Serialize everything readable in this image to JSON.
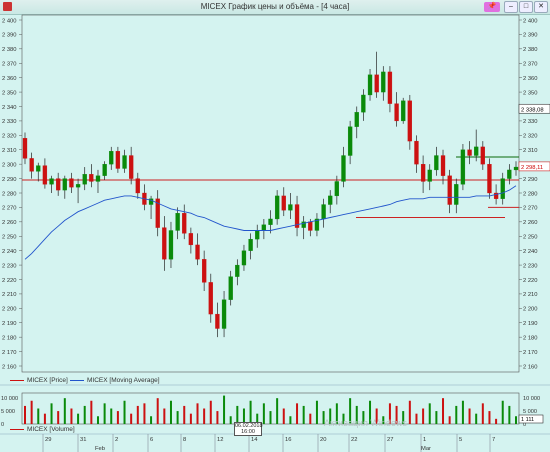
{
  "window": {
    "title": "MICEX График цены и объёма - [4 часа]",
    "minimize": "–",
    "maximize": "□",
    "close": "✕",
    "pin": "📌"
  },
  "price_axis": {
    "ticks": [
      "2 400",
      "2 390",
      "2 380",
      "2 370",
      "2 360",
      "2 350",
      "2 340",
      "2 330",
      "2 320",
      "2 310",
      "2 300",
      "2 290",
      "2 280",
      "2 270",
      "2 260",
      "2 250",
      "2 240",
      "2 230",
      "2 220",
      "2 210",
      "2 200",
      "2 190",
      "2 180",
      "2 170",
      "2 160"
    ],
    "badge_upper": "2 338,08",
    "badge_current": "2 298,11"
  },
  "volume_axis": {
    "ticks": [
      "10 000",
      "5 000",
      "0"
    ],
    "badge": "1 111"
  },
  "legend": {
    "price": "MICEX [Price]",
    "ma": "MICEX [Moving Average]",
    "volume": "MICEX [Volume]"
  },
  "date_axis": {
    "days": [
      "29",
      "31",
      "2",
      "6",
      "8",
      "12",
      "14",
      "16",
      "20",
      "22",
      "27",
      "1",
      "5",
      "7"
    ],
    "months": [
      "Feb",
      "Mar"
    ],
    "crosshair_date": "06.02.2018",
    "crosshair_time": "16:00"
  },
  "watermark": "Активация Windows",
  "colors": {
    "up": "#0a8a0a",
    "down": "#cc1111",
    "ma": "#2255cc",
    "hline": "#cc2222",
    "hline_green": "#0a6a0a",
    "background": "#d4f3f0"
  },
  "chart_data": [
    {
      "type": "candlestick",
      "title": "MICEX График цены и объёма - [4 часа]",
      "ylim": [
        2160,
        2400
      ],
      "y_ticks": [
        2400,
        2390,
        2380,
        2370,
        2360,
        2350,
        2340,
        2330,
        2320,
        2310,
        2300,
        2290,
        2280,
        2270,
        2260,
        2250,
        2240,
        2230,
        2220,
        2210,
        2200,
        2190,
        2180,
        2170,
        2160
      ],
      "grid": false,
      "series": [
        {
          "name": "MICEX [Price]",
          "ohlc": [
            [
              2318,
              2322,
              2300,
              2304
            ],
            [
              2304,
              2308,
              2290,
              2295
            ],
            [
              2295,
              2301,
              2288,
              2299
            ],
            [
              2299,
              2304,
              2283,
              2286
            ],
            [
              2286,
              2292,
              2280,
              2290
            ],
            [
              2290,
              2294,
              2278,
              2282
            ],
            [
              2282,
              2292,
              2276,
              2290
            ],
            [
              2290,
              2294,
              2280,
              2284
            ],
            [
              2284,
              2290,
              2273,
              2286
            ],
            [
              2286,
              2298,
              2282,
              2293
            ],
            [
              2293,
              2300,
              2284,
              2288
            ],
            [
              2288,
              2296,
              2280,
              2292
            ],
            [
              2292,
              2302,
              2289,
              2300
            ],
            [
              2300,
              2312,
              2296,
              2309
            ],
            [
              2309,
              2312,
              2294,
              2297
            ],
            [
              2297,
              2310,
              2294,
              2306
            ],
            [
              2306,
              2312,
              2286,
              2290
            ],
            [
              2290,
              2294,
              2276,
              2280
            ],
            [
              2280,
              2286,
              2268,
              2272
            ],
            [
              2272,
              2278,
              2262,
              2276
            ],
            [
              2276,
              2282,
              2250,
              2256
            ],
            [
              2256,
              2264,
              2226,
              2234
            ],
            [
              2234,
              2260,
              2228,
              2254
            ],
            [
              2254,
              2270,
              2248,
              2266
            ],
            [
              2266,
              2272,
              2248,
              2252
            ],
            [
              2252,
              2256,
              2238,
              2244
            ],
            [
              2244,
              2252,
              2230,
              2234
            ],
            [
              2234,
              2240,
              2212,
              2218
            ],
            [
              2218,
              2224,
              2190,
              2196
            ],
            [
              2196,
              2204,
              2180,
              2186
            ],
            [
              2186,
              2212,
              2180,
              2206
            ],
            [
              2206,
              2226,
              2202,
              2222
            ],
            [
              2222,
              2234,
              2216,
              2230
            ],
            [
              2230,
              2244,
              2226,
              2240
            ],
            [
              2240,
              2252,
              2234,
              2248
            ],
            [
              2248,
              2258,
              2242,
              2254
            ],
            [
              2254,
              2262,
              2248,
              2258
            ],
            [
              2258,
              2268,
              2252,
              2262
            ],
            [
              2262,
              2282,
              2258,
              2278
            ],
            [
              2278,
              2284,
              2264,
              2268
            ],
            [
              2268,
              2280,
              2262,
              2272
            ],
            [
              2272,
              2278,
              2250,
              2256
            ],
            [
              2256,
              2264,
              2248,
              2260
            ],
            [
              2260,
              2262,
              2250,
              2254
            ],
            [
              2254,
              2266,
              2250,
              2262
            ],
            [
              2262,
              2276,
              2256,
              2272
            ],
            [
              2272,
              2282,
              2266,
              2278
            ],
            [
              2278,
              2292,
              2272,
              2288
            ],
            [
              2288,
              2312,
              2284,
              2306
            ],
            [
              2306,
              2330,
              2300,
              2326
            ],
            [
              2326,
              2340,
              2318,
              2336
            ],
            [
              2336,
              2352,
              2330,
              2348
            ],
            [
              2348,
              2366,
              2344,
              2362
            ],
            [
              2362,
              2378,
              2346,
              2350
            ],
            [
              2350,
              2368,
              2344,
              2364
            ],
            [
              2364,
              2368,
              2336,
              2342
            ],
            [
              2342,
              2350,
              2326,
              2330
            ],
            [
              2330,
              2346,
              2328,
              2344
            ],
            [
              2344,
              2348,
              2310,
              2316
            ],
            [
              2316,
              2320,
              2294,
              2300
            ],
            [
              2300,
              2306,
              2280,
              2288
            ],
            [
              2288,
              2300,
              2282,
              2296
            ],
            [
              2296,
              2312,
              2292,
              2306
            ],
            [
              2306,
              2310,
              2286,
              2292
            ],
            [
              2292,
              2296,
              2266,
              2272
            ],
            [
              2272,
              2290,
              2266,
              2286
            ],
            [
              2286,
              2314,
              2282,
              2310
            ],
            [
              2310,
              2316,
              2300,
              2306
            ],
            [
              2306,
              2324,
              2302,
              2312
            ],
            [
              2312,
              2316,
              2296,
              2300
            ],
            [
              2300,
              2304,
              2276,
              2280
            ],
            [
              2280,
              2286,
              2272,
              2276
            ],
            [
              2276,
              2294,
              2272,
              2290
            ],
            [
              2290,
              2300,
              2286,
              2296
            ],
            [
              2296,
              2302,
              2292,
              2298
            ]
          ]
        },
        {
          "name": "MICEX [Moving Average]",
          "values": [
            2234,
            2238,
            2243,
            2248,
            2253,
            2257,
            2261,
            2264,
            2267,
            2269,
            2271,
            2273,
            2275,
            2276,
            2277,
            2278,
            2278,
            2277,
            2276,
            2275,
            2273,
            2271,
            2269,
            2268,
            2267,
            2266,
            2264,
            2263,
            2261,
            2259,
            2257,
            2256,
            2255,
            2254,
            2254,
            2254,
            2254,
            2254,
            2255,
            2256,
            2257,
            2258,
            2259,
            2260,
            2261,
            2262,
            2263,
            2264,
            2265,
            2266,
            2267,
            2268,
            2269,
            2270,
            2271,
            2272,
            2274,
            2275,
            2276,
            2276,
            2276,
            2277,
            2277,
            2277,
            2277,
            2277,
            2277,
            2277,
            2278,
            2278,
            2278,
            2279,
            2280,
            2282,
            2285
          ]
        }
      ],
      "horizontal_lines": [
        {
          "y": 2289,
          "color": "#cc2222"
        },
        {
          "y": 2305,
          "color": "#0a6a0a"
        },
        {
          "y": 2270,
          "color": "#cc2222"
        },
        {
          "y": 2263,
          "color": "#cc2222"
        }
      ]
    },
    {
      "type": "bar",
      "title": "MICEX [Volume]",
      "ylim": [
        0,
        12000
      ],
      "y_ticks": [
        10000,
        5000,
        0
      ],
      "series": [
        {
          "name": "MICEX [Volume]",
          "values": [
            7000,
            9000,
            6000,
            4000,
            8000,
            5000,
            10000,
            6000,
            4000,
            7000,
            9000,
            3000,
            8000,
            6000,
            5000,
            9000,
            4000,
            7000,
            8000,
            3000,
            10000,
            6000,
            9000,
            5000,
            7000,
            4000,
            8000,
            6000,
            9000,
            5000,
            11000,
            3000,
            7000,
            6000,
            9000,
            4000,
            8000,
            5000,
            10000,
            6000,
            3000,
            8000,
            7000,
            4000,
            9000,
            5000,
            6000,
            8000,
            4000,
            10000,
            7000,
            5000,
            9000,
            6000,
            3000,
            8000,
            7000,
            5000,
            9000,
            4000,
            6000,
            8000,
            5000,
            10000,
            3000,
            7000,
            9000,
            6000,
            4000,
            8000,
            5000,
            2000,
            9000,
            7000,
            3000
          ]
        }
      ]
    }
  ]
}
